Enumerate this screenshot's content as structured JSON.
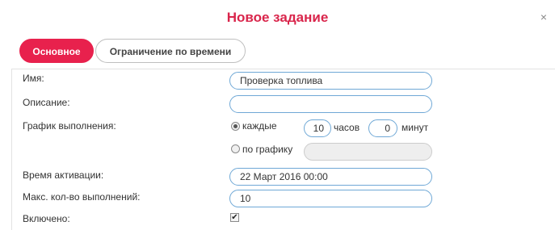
{
  "dialog": {
    "title": "Новое задание",
    "close_symbol": "×"
  },
  "tabs": [
    {
      "label": "Основное",
      "active": true
    },
    {
      "label": "Ограничение по времени",
      "active": false
    }
  ],
  "form": {
    "name": {
      "label": "Имя:",
      "value": "Проверка топлива"
    },
    "description": {
      "label": "Описание:",
      "value": ""
    },
    "schedule": {
      "label": "График выполнения:",
      "every": {
        "label": "каждые",
        "selected": true,
        "hours_value": "10",
        "hours_unit": "часов",
        "minutes_value": "0",
        "minutes_unit": "минут"
      },
      "by_schedule": {
        "label": "по графику",
        "selected": false,
        "value": ""
      }
    },
    "activation_time": {
      "label": "Время активации:",
      "value": "22 Март 2016 00:00"
    },
    "max_executions": {
      "label": "Макс. кол-во выполнений:",
      "value": "10"
    },
    "enabled": {
      "label": "Включено:",
      "checked": true,
      "check_symbol": "✔"
    }
  },
  "colors": {
    "accent": "#e8214d",
    "title": "#d9254b",
    "input_border": "#6fa8d6"
  }
}
